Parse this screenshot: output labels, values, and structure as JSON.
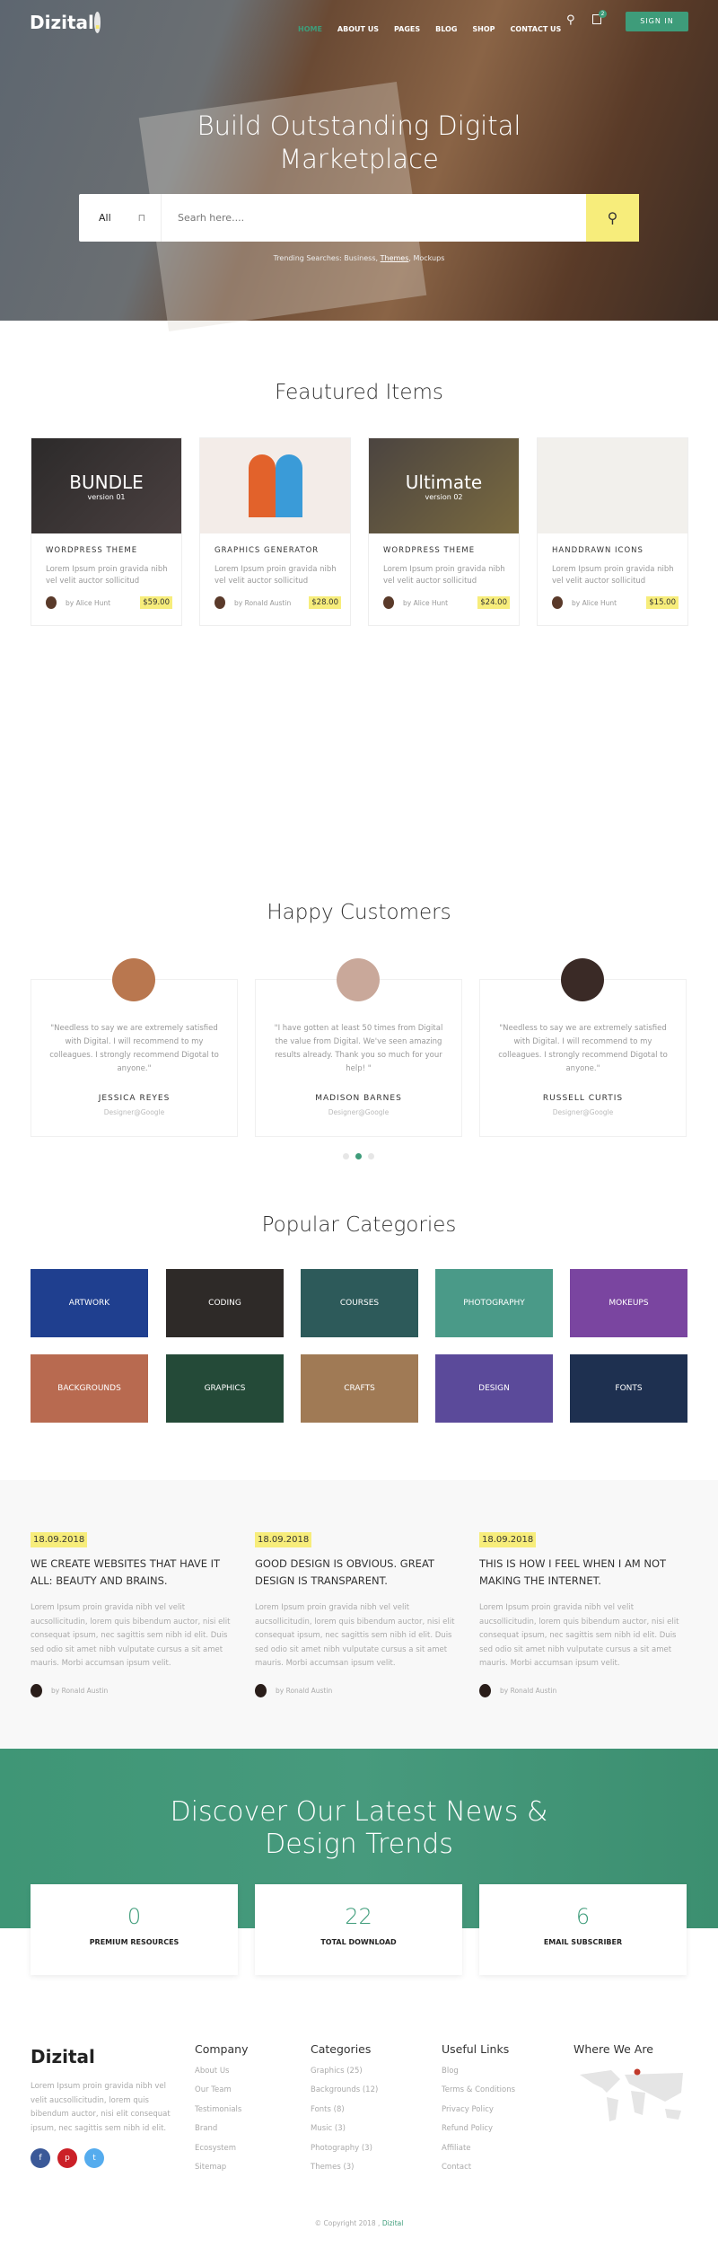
{
  "header": {
    "logo": "Dizital",
    "logo_dot": ".",
    "nav": [
      "HOME",
      "ABOUT US",
      "PAGES",
      "BLOG",
      "SHOP",
      "CONTACT US"
    ],
    "cart_count": "2",
    "signin": "SIGN IN"
  },
  "hero": {
    "title": "Build Outstanding Digital Marketplace",
    "search": {
      "category": "All",
      "placeholder": "Searh here....",
      "button_icon": "search-icon"
    },
    "trending_label": "Trending Searches:",
    "trending": [
      "Business",
      "Themes",
      "Mockups"
    ]
  },
  "featured": {
    "title": "Feautured Items",
    "items": [
      {
        "image_title": "BUNDLE",
        "image_sub": "version 01",
        "title": "WORDPRESS THEME",
        "desc": "Lorem Ipsum proin gravida nibh vel velit auctor sollicitud",
        "author": "by Alice Hunt",
        "price": "$59.00"
      },
      {
        "image_title": "",
        "image_sub": "",
        "title": "GRAPHICS GENERATOR",
        "desc": "Lorem Ipsum proin gravida nibh vel velit auctor sollicitud",
        "author": "by Ronald Austin",
        "price": "$28.00"
      },
      {
        "image_title": "Ultimate",
        "image_sub": "version 02",
        "title": "WORDPRESS THEME",
        "desc": "Lorem Ipsum proin gravida nibh vel velit auctor sollicitud",
        "author": "by Alice Hunt",
        "price": "$24.00"
      },
      {
        "image_title": "",
        "image_sub": "",
        "title": "HANDDRAWN ICONS",
        "desc": "Lorem Ipsum proin gravida nibh vel velit auctor sollicitud",
        "author": "by Alice Hunt",
        "price": "$15.00"
      }
    ]
  },
  "testimonials": {
    "title": "Happy Customers",
    "items": [
      {
        "quote": "\"Needless to say we are extremely satisfied with Digital. I will recommend to my colleagues. I strongly recommend Digotal to anyone.\"",
        "name": "JESSICA REYES",
        "role": "Designer@Google"
      },
      {
        "quote": "\"I have gotten at least 50 times from Digital the value from Digital. We've seen amazing results already. Thank you so much for your help! \"",
        "name": "MADISON BARNES",
        "role": "Designer@Google"
      },
      {
        "quote": "\"Needless to say we are extremely satisfied with Digital. I will recommend to my colleagues. I strongly recommend Digotal to anyone.\"",
        "name": "RUSSELL CURTIS",
        "role": "Designer@Google"
      }
    ],
    "active_dot": 2
  },
  "categories": {
    "title": "Popular Categories",
    "items": [
      "ARTWORK",
      "CODING",
      "COURSES",
      "PHOTOGRAPHY",
      "MOKEUPS",
      "BACKGROUNDS",
      "GRAPHICS",
      "CRAFTS",
      "DESIGN",
      "FONTS"
    ]
  },
  "blog": {
    "posts": [
      {
        "date": "18.09.2018",
        "title": "WE CREATE WEBSITES THAT HAVE IT ALL: BEAUTY AND BRAINS.",
        "body": "Lorem Ipsum proin gravida nibh vel velit aucsollicitudin, lorem quis bibendum auctor, nisi elit consequat ipsum, nec sagittis sem nibh id elit. Duis sed odio sit amet nibh vulputate cursus a sit amet mauris. Morbi accumsan ipsum velit.",
        "author": "by Ronald Austin"
      },
      {
        "date": "18.09.2018",
        "title": "GOOD DESIGN IS OBVIOUS. GREAT DESIGN IS TRANSPARENT.",
        "body": "Lorem Ipsum proin gravida nibh vel velit aucsollicitudin, lorem quis bibendum auctor, nisi elit consequat ipsum, nec sagittis sem nibh id elit. Duis sed odio sit amet nibh vulputate cursus a sit amet mauris. Morbi accumsan ipsum velit.",
        "author": "by Ronald Austin"
      },
      {
        "date": "18.09.2018",
        "title": "THIS IS HOW I FEEL WHEN I AM NOT MAKING THE INTERNET.",
        "body": "Lorem Ipsum proin gravida nibh vel velit aucsollicitudin, lorem quis bibendum auctor, nisi elit consequat ipsum, nec sagittis sem nibh id elit. Duis sed odio sit amet nibh vulputate cursus a sit amet mauris. Morbi accumsan ipsum velit.",
        "author": "by Ronald Austin"
      }
    ]
  },
  "stats": {
    "title": "Discover Our Latest News & Design Trends",
    "items": [
      {
        "value": "0",
        "label": "PREMIUM RESOURCES"
      },
      {
        "value": "22",
        "label": "TOTAL DOWNLOAD"
      },
      {
        "value": "6",
        "label": "EMAIL SUBSCRIBER"
      }
    ]
  },
  "footer": {
    "logo": "Dizital",
    "about": "Lorem Ipsum proin gravida nibh vel velit aucsollicitudin, lorem quis bibendum auctor, nisi elit consequat ipsum, nec sagittis sem nibh id elit.",
    "social": [
      "facebook-icon",
      "pinterest-icon",
      "twitter-icon"
    ],
    "company": {
      "title": "Company",
      "links": [
        "About Us",
        "Our Team",
        "Testimonials",
        "Brand",
        "Ecosystem",
        "Sitemap"
      ]
    },
    "categories": {
      "title": "Categories",
      "links": [
        "Graphics (25)",
        "Backgrounds (12)",
        "Fonts (8)",
        "Music (3)",
        "Photography (3)",
        "Themes (3)"
      ]
    },
    "useful": {
      "title": "Useful Links",
      "links": [
        "Blog",
        "Terms & Conditions",
        "Privacy Policy",
        "Refund Policy",
        "Affiliate",
        "Contact"
      ]
    },
    "where": {
      "title": "Where We Are"
    },
    "copyright": "© Copyright 2018 ,",
    "copyright_brand": "Dizital"
  },
  "colors": {
    "accent": "#3e9c7a",
    "highlight": "#f7ed7b"
  }
}
